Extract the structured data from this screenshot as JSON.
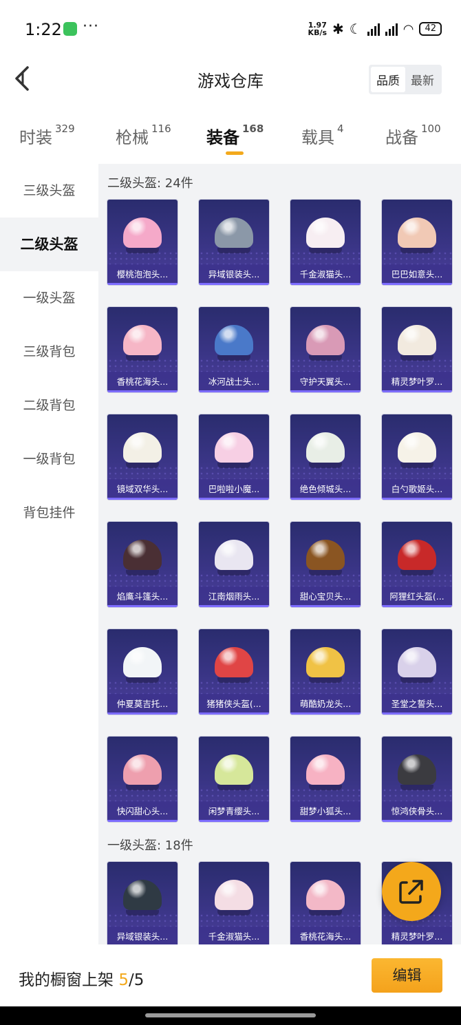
{
  "status_bar": {
    "time": "1:22",
    "net_speed_value": "1.97",
    "net_speed_unit": "KB/s",
    "battery": "42",
    "more": "···"
  },
  "header": {
    "title": "游戏仓库",
    "sort_options": [
      "品质",
      "最新"
    ]
  },
  "tabs": [
    {
      "label": "时装",
      "count": "329"
    },
    {
      "label": "枪械",
      "count": "116"
    },
    {
      "label": "装备",
      "count": "168"
    },
    {
      "label": "载具",
      "count": "4"
    },
    {
      "label": "战备",
      "count": "100"
    }
  ],
  "sidebar": [
    "三级头盔",
    "二级头盔",
    "一级头盔",
    "三级背包",
    "二级背包",
    "一级背包",
    "背包挂件"
  ],
  "sections": [
    {
      "title": "二级头盔: 24件",
      "items": [
        {
          "name": "樱桃泡泡头...",
          "color": "#f5a9c9"
        },
        {
          "name": "异域银装头...",
          "color": "#8b98a8"
        },
        {
          "name": "千金淑猫头...",
          "color": "#f7eef2"
        },
        {
          "name": "巴巴如意头...",
          "color": "#f1c9b5"
        },
        {
          "name": "香桃花海头...",
          "color": "#f6b6c6"
        },
        {
          "name": "冰河战士头...",
          "color": "#4a79c9"
        },
        {
          "name": "守护天翼头...",
          "color": "#d99ab6"
        },
        {
          "name": "精灵梦叶罗...",
          "color": "#f2eadf"
        },
        {
          "name": "镜域双华头...",
          "color": "#f3f0e6"
        },
        {
          "name": "巴啦啦小魔...",
          "color": "#f7cfe4"
        },
        {
          "name": "绝色倾城头...",
          "color": "#e8eee6"
        },
        {
          "name": "白勺歌姬头...",
          "color": "#f6f2e8"
        },
        {
          "name": "焰鹰斗篷头...",
          "color": "#4a2f34"
        },
        {
          "name": "江南烟雨头...",
          "color": "#e9e6f1"
        },
        {
          "name": "甜心宝贝头...",
          "color": "#8a5522"
        },
        {
          "name": "阿狸红头盔(...",
          "color": "#c82929"
        },
        {
          "name": "仲夏莫吉托...",
          "color": "#f2f5f7"
        },
        {
          "name": "猪猪侠头盔(...",
          "color": "#e04545"
        },
        {
          "name": "萌酷奶龙头...",
          "color": "#f0c245"
        },
        {
          "name": "圣堂之誓头...",
          "color": "#d9d1ea"
        },
        {
          "name": "快闪甜心头...",
          "color": "#ee9fae"
        },
        {
          "name": "闲梦青缨头...",
          "color": "#d6e79a"
        },
        {
          "name": "甜梦小狐头...",
          "color": "#f7b2c3"
        },
        {
          "name": "惊鸿侠骨头...",
          "color": "#3b3b40"
        }
      ]
    },
    {
      "title": "一级头盔: 18件",
      "items": [
        {
          "name": "异域银装头...",
          "color": "#2f3a44"
        },
        {
          "name": "千金淑猫头...",
          "color": "#f4dde4"
        },
        {
          "name": "香桃花海头...",
          "color": "#f3b8c7"
        },
        {
          "name": "精灵梦叶罗...",
          "color": "#f2eadf"
        }
      ]
    }
  ],
  "bottom": {
    "showcase_label": "我的橱窗上架",
    "current": "5",
    "total": "/5",
    "edit_label": "编辑"
  },
  "fab": {
    "icon": "share-export-icon"
  }
}
